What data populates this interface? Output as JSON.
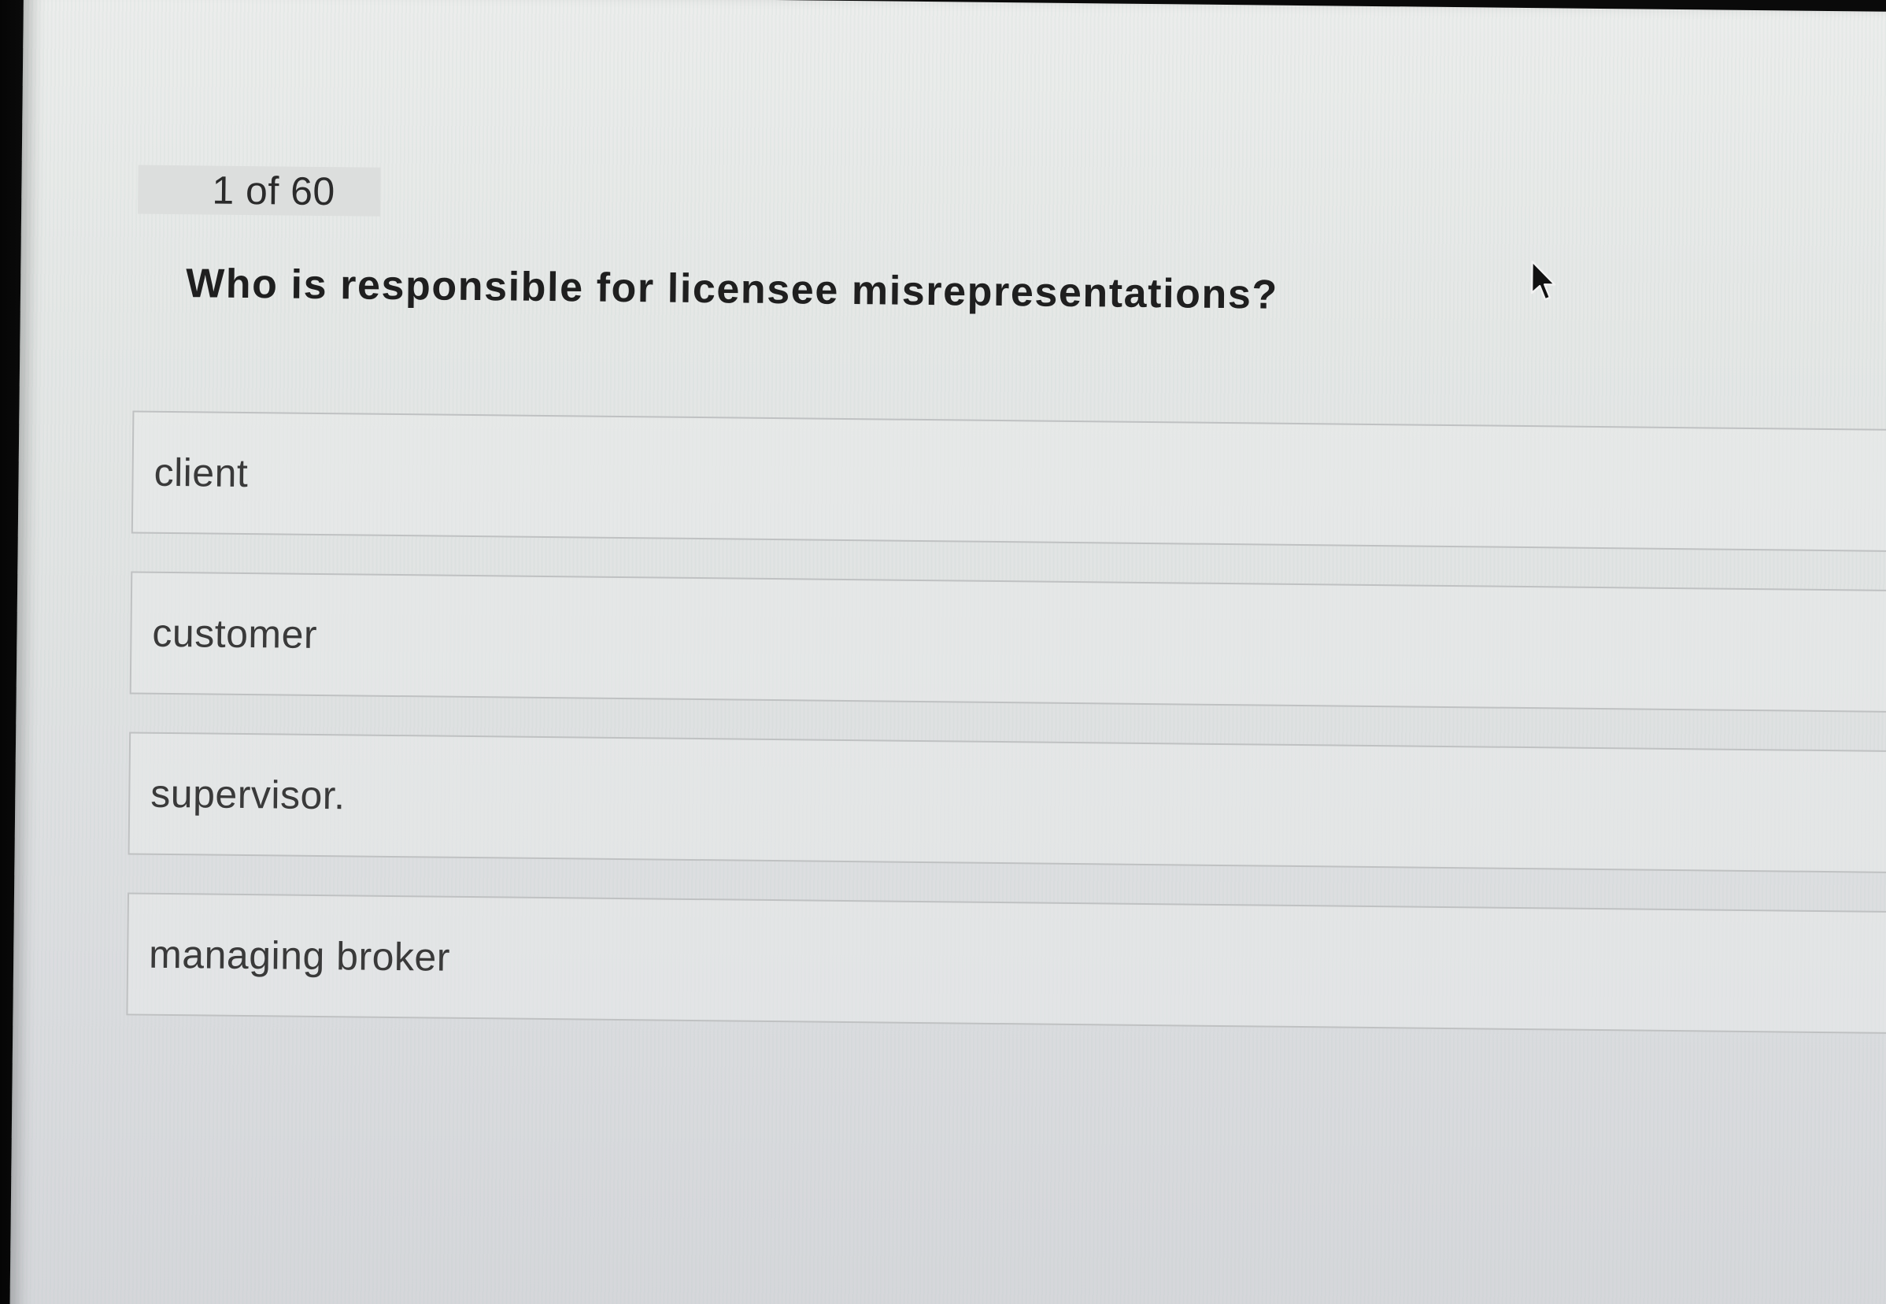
{
  "quiz": {
    "progress": "1 of 60",
    "question": "Who is responsible for licensee misrepresentations?",
    "options": [
      {
        "label": "client"
      },
      {
        "label": "customer"
      },
      {
        "label": "supervisor."
      },
      {
        "label": "managing broker"
      }
    ]
  },
  "icons": {
    "cursor": "mouse-pointer-icon"
  }
}
